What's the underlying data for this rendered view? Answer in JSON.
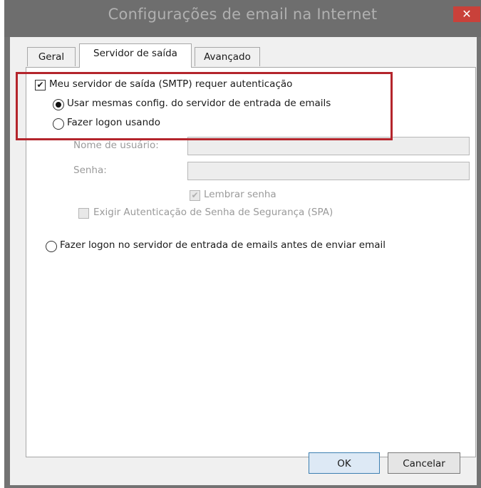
{
  "window": {
    "title": "Configurações de email na Internet"
  },
  "title_bar": {
    "close_glyph": "✕"
  },
  "tabs": [
    {
      "label": "Geral"
    },
    {
      "label": "Servidor de saída"
    },
    {
      "label": "Avançado"
    }
  ],
  "auth": {
    "requires_auth_label": "Meu servidor de saída (SMTP) requer autenticação",
    "requires_auth_checked": true,
    "use_same_label": "Usar mesmas config. do servidor de entrada de emails",
    "use_same_selected": true,
    "logon_using_label": "Fazer logon usando",
    "logon_using_selected": false,
    "username_label": "Nome de usuário:",
    "username_value": "",
    "password_label": "Senha:",
    "password_value": "",
    "remember_password_label": "Lembrar senha",
    "remember_password_checked": true,
    "spa_label": "Exigir Autenticação de Senha de Segurança (SPA)",
    "spa_checked": false,
    "logon_before_send_label": "Fazer logon no servidor de entrada de emails antes de enviar email",
    "logon_before_send_selected": false
  },
  "buttons": {
    "ok": "OK",
    "cancel": "Cancelar"
  },
  "glyphs": {
    "check": "✔"
  },
  "colors": {
    "highlight_border": "#b4252c",
    "title_bar": "#6e6e6e",
    "close_button": "#c9413a"
  }
}
